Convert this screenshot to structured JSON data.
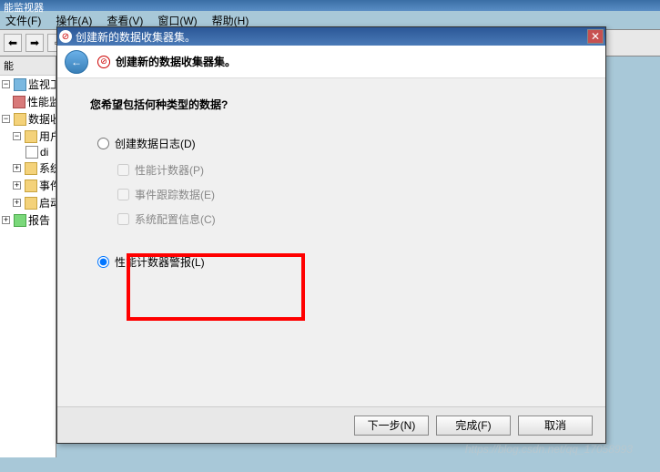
{
  "main_window": {
    "title_fragment": "能监视器",
    "menu": {
      "file": "文件(F)",
      "action": "操作(A)",
      "view": "查看(V)",
      "window": "窗口(W)",
      "help": "帮助(H)"
    }
  },
  "tree": {
    "header": "能",
    "items": [
      {
        "label": "监视工具",
        "icon": "tool"
      },
      {
        "label": "性能监",
        "icon": "red"
      },
      {
        "label": "数据收集",
        "icon": "folder"
      },
      {
        "label": "用户定",
        "icon": "folder"
      },
      {
        "label": "di",
        "icon": "page"
      },
      {
        "label": "系统",
        "icon": "folder"
      },
      {
        "label": "事件跟",
        "icon": "folder"
      },
      {
        "label": "启动事",
        "icon": "folder"
      },
      {
        "label": "报告",
        "icon": "green"
      }
    ]
  },
  "dialog": {
    "titlebar": "创建新的数据收集器集。",
    "header_title": "创建新的数据收集器集。",
    "question": "您希望包括何种类型的数据?",
    "options": {
      "create_log": "创建数据日志(D)",
      "perf_counter": "性能计数器(P)",
      "event_trace": "事件跟踪数据(E)",
      "sys_config": "系统配置信息(C)",
      "perf_alert": "性能计数器警报(L)"
    },
    "buttons": {
      "next": "下一步(N)",
      "finish": "完成(F)",
      "cancel": "取消"
    }
  },
  "watermark": "https://blog.csdn.net/qq_17058993"
}
